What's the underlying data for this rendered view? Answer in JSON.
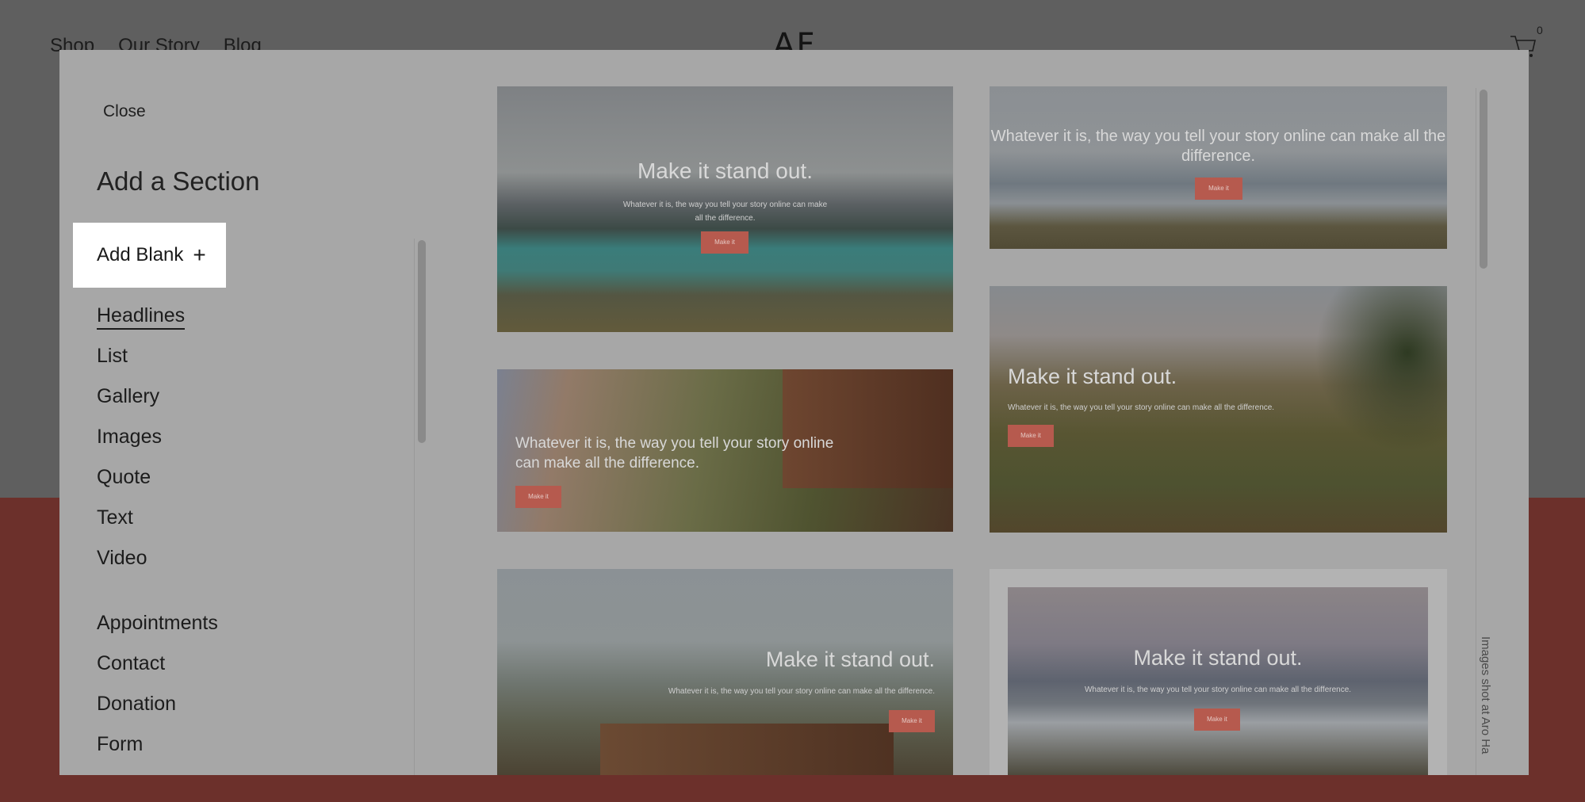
{
  "site": {
    "nav": [
      "Shop",
      "Our Story",
      "Blog"
    ],
    "logo": "AF",
    "cart_count": "0"
  },
  "modal": {
    "close_label": "Close",
    "title": "Add a Section",
    "add_blank_label": "Add Blank",
    "add_blank_icon": "plus-icon",
    "categories_group1": [
      "Headlines",
      "List",
      "Gallery",
      "Images",
      "Quote",
      "Text",
      "Video"
    ],
    "categories_group2": [
      "Appointments",
      "Contact",
      "Donation",
      "Form"
    ],
    "active_category": "Headlines",
    "credit": "Images shot at Aro Ha"
  },
  "templates": [
    {
      "headline": "Make it stand out.",
      "sub": "Whatever it is, the way you tell your story online can make all the difference.",
      "cta": "Make it"
    },
    {
      "headline": "Whatever it is, the way you tell your story online can make all the difference.",
      "cta": "Make it"
    },
    {
      "headline": "Whatever it is, the way you tell your story online can make all the difference.",
      "cta": "Make it"
    },
    {
      "headline": "Make it stand out.",
      "sub": "Whatever it is, the way you tell your story online can make all the difference.",
      "cta": "Make it"
    },
    {
      "headline": "Make it stand out.",
      "sub": "Whatever it is, the way you tell your story online can make all the difference.",
      "cta": "Make it"
    },
    {
      "headline": "Make it stand out.",
      "sub": "Whatever it is, the way you tell your story online can make all the difference.",
      "cta": "Make it"
    }
  ]
}
